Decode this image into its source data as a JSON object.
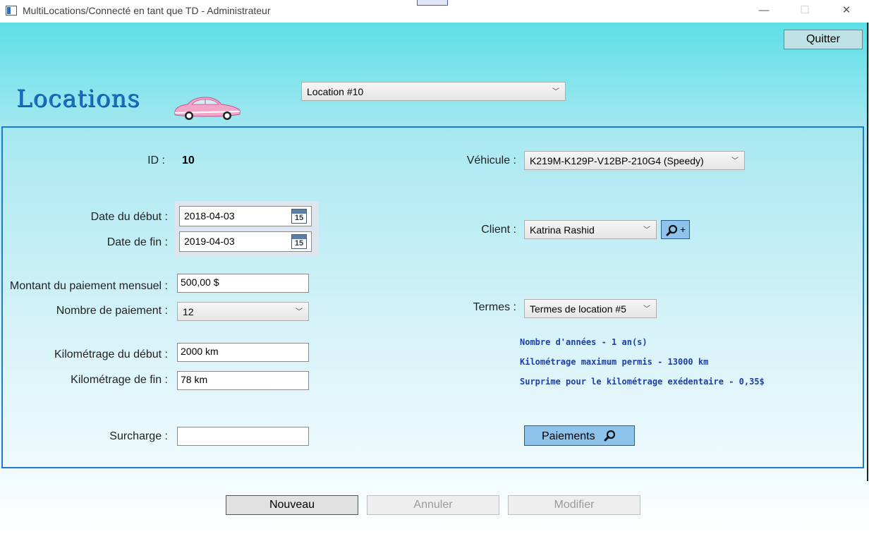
{
  "window": {
    "title": "MultiLocations/Connecté en tant que TD - Administrateur",
    "minimize": "—",
    "maximize": "☐",
    "close": "✕"
  },
  "header": {
    "quit_label": "Quitter",
    "title": "Locations",
    "location_select": "Location #10"
  },
  "form": {
    "id_label": "ID :",
    "id_value": "10",
    "date_start_label": "Date du début :",
    "date_start_value": "2018-04-03",
    "date_end_label": "Date de fin :",
    "date_end_value": "2019-04-03",
    "calendar_day": "15",
    "monthly_payment_label": "Montant du paiement mensuel :",
    "monthly_payment_value": "500,00 $",
    "payments_count_label": "Nombre de paiement :",
    "payments_count_value": "12",
    "km_start_label": "Kilométrage du début :",
    "km_start_value": "2000 km",
    "km_end_label": "Kilométrage de fin :",
    "km_end_value": "78 km",
    "surcharge_label": "Surcharge :",
    "surcharge_value": "",
    "vehicle_label": "Véhicule :",
    "vehicle_value": "K219M-K129P-V12BP-210G4  (Speedy)",
    "client_label": "Client :",
    "client_value": "Katrina Rashid",
    "client_add": "+",
    "terms_label": "Termes :",
    "terms_value": "Termes de location #5",
    "terms_info": [
      "Nombre d'années - 1 an(s)",
      "Kilométrage maximum permis - 13000 km",
      "Surprime pour le kilométrage exédentaire - 0,35$"
    ],
    "payments_button": "Paiements"
  },
  "footer": {
    "new_label": "Nouveau",
    "cancel_label": "Annuler",
    "edit_label": "Modifier"
  },
  "colors": {
    "accent": "#1e7ad8",
    "gradient_top": "#5ddfe6",
    "info_text": "#1c3fa8",
    "button_blue": "#8ec4ec"
  }
}
